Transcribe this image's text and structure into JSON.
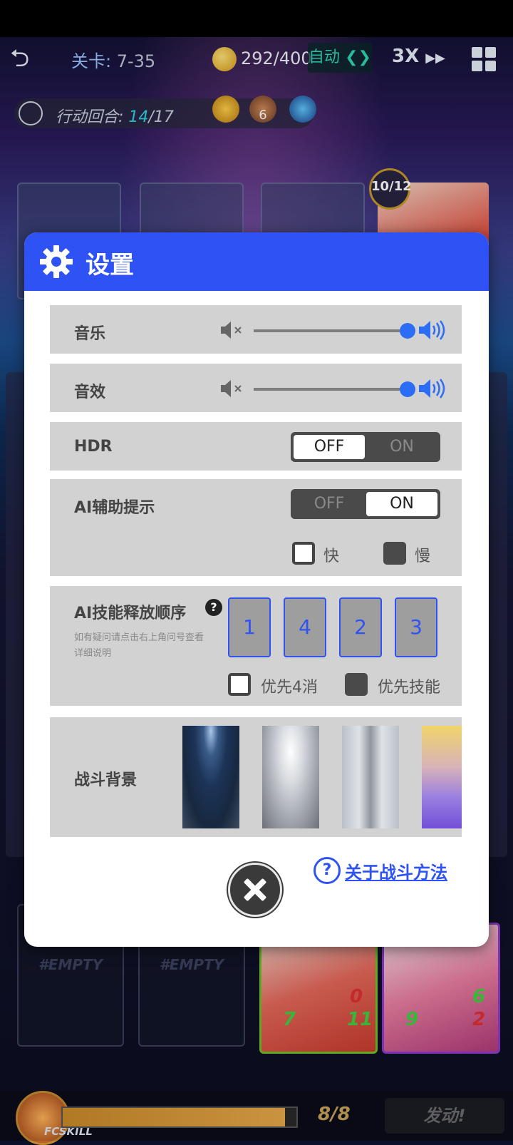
{
  "topbar": {
    "stage_label": "关卡:",
    "stage_value": "7-35",
    "energy": "292/400",
    "auto_label": "自动",
    "speed": "3X"
  },
  "turn": {
    "label": "行动回合:",
    "current": "14",
    "total": "/17",
    "badge_count": "6"
  },
  "counter_badge": "10/12",
  "empty_slots": [
    "#EMPTY",
    "#EMPTY"
  ],
  "hero_cards": [
    {
      "shield": "0",
      "attack": "7",
      "health": "11"
    },
    {
      "shield": "6",
      "attack": "9",
      "health": "2"
    }
  ],
  "skill": {
    "name": "FCSKILL",
    "count": "8/8",
    "progress": 0.95,
    "launch": "发动!"
  },
  "settings": {
    "title": "设置",
    "music": {
      "label": "音乐",
      "level": 1.0
    },
    "sfx": {
      "label": "音效",
      "level": 1.0
    },
    "hdr": {
      "label": "HDR",
      "off": "OFF",
      "on": "ON",
      "selected": "OFF"
    },
    "ai_hint": {
      "label": "AI辅助提示",
      "off": "OFF",
      "on": "ON",
      "selected": "ON",
      "fast": "快",
      "slow": "慢"
    },
    "ai_order": {
      "label": "AI技能释放顺序",
      "help": "?",
      "hint": "如有疑问请点击右上角问号查看详细说明",
      "order": [
        "1",
        "4",
        "2",
        "3"
      ],
      "prefer4": "优先4消",
      "preferSkill": "优先技能"
    },
    "battle_bg": {
      "label": "战斗背景"
    },
    "help_link": "关于战斗方法",
    "colors": {
      "accent": "#2f52f4",
      "row": "#d2d2d2"
    }
  }
}
